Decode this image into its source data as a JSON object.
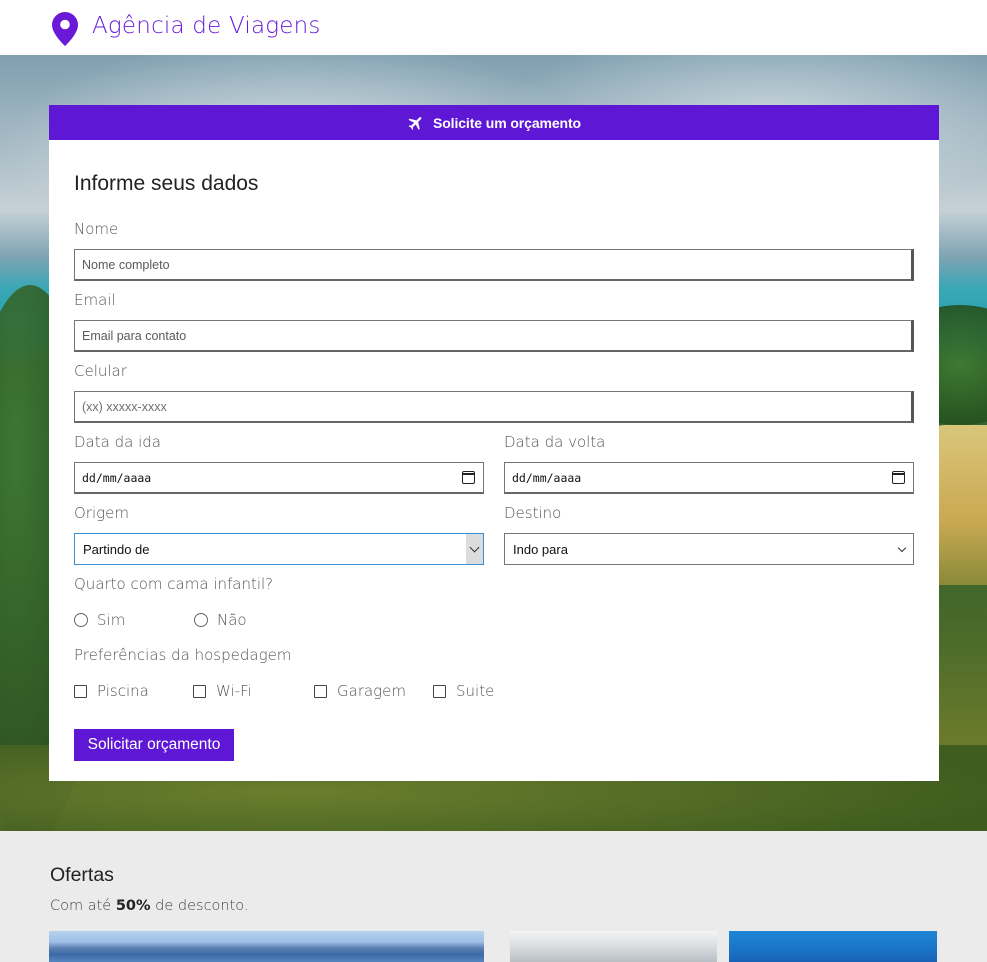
{
  "header": {
    "brand": "Agência de Viagens",
    "logo_icon": "map-pin-icon",
    "brand_color": "#6a1ad6"
  },
  "form": {
    "header_title": "Solicite um orçamento",
    "header_icon": "airplane-icon",
    "accent_color": "#5e17d4",
    "title": "Informe seus dados",
    "nome": {
      "label": "Nome",
      "placeholder": "Nome completo"
    },
    "email": {
      "label": "Email",
      "placeholder": "Email para contato"
    },
    "celular": {
      "label": "Celular",
      "placeholder": "(xx) xxxxx-xxxx"
    },
    "data_ida": {
      "label": "Data da ida",
      "value": "dd/mm/aaaa"
    },
    "data_volta": {
      "label": "Data da volta",
      "value": "dd/mm/aaaa"
    },
    "origem": {
      "label": "Origem",
      "value": "Partindo de"
    },
    "destino": {
      "label": "Destino",
      "value": "Indo para"
    },
    "quarto": {
      "label": "Quarto com cama infantil?",
      "options": [
        "Sim",
        "Não"
      ]
    },
    "preferencias": {
      "label": "Preferências da hospedagem",
      "options": [
        "Piscina",
        "Wi-Fi",
        "Garagem",
        "Suite"
      ]
    },
    "submit_label": "Solicitar orçamento"
  },
  "offers": {
    "title": "Ofertas",
    "subtitle_prefix": "Com até ",
    "subtitle_highlight": "50%",
    "subtitle_suffix": " de desconto."
  }
}
